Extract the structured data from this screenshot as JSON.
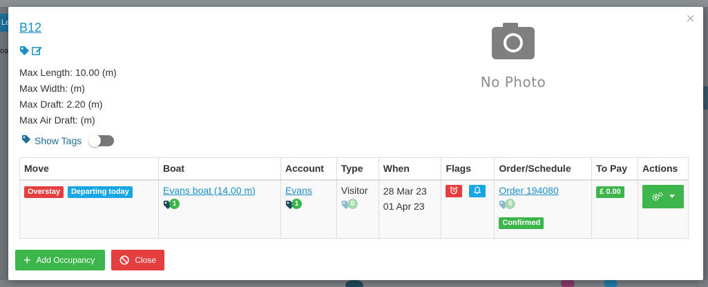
{
  "background": {
    "left_button_text": "Le",
    "left_side_text": "oa"
  },
  "modal": {
    "close_symbol": "×",
    "berth_name": "B12",
    "icons": [
      "tag-icon",
      "edit-icon"
    ],
    "specs": [
      "Max Length: 10.00 (m)",
      "Max Width: (m)",
      "Max Draft: 2.20 (m)",
      "Max Air Draft: (m)"
    ],
    "photo": {
      "icon": "camera-icon",
      "label": "No Photo"
    },
    "show_tags": {
      "label": "Show Tags",
      "enabled": false
    },
    "table": {
      "headers": [
        "Move",
        "Boat",
        "Account",
        "Type",
        "When",
        "Flags",
        "Order/Schedule",
        "To Pay",
        "Actions"
      ],
      "rows": [
        {
          "move_badges": [
            "Overstay",
            "Departing today"
          ],
          "boat": {
            "label": "Evans boat (14.00 m)",
            "tag_count": "1"
          },
          "account": {
            "label": "Evans",
            "tag_count": "1"
          },
          "type": {
            "label": "Visitor",
            "tag_count": "0"
          },
          "when": {
            "from": "28 Mar 23",
            "to": "01 Apr 23"
          },
          "flags": [
            "alarm-clock-icon",
            "bell-icon"
          ],
          "order": {
            "label": "Order 194080",
            "tag_count": "0",
            "status": "Confirmed"
          },
          "to_pay": "£ 0.00",
          "actions": {
            "icon": "gears-icon",
            "caret": "caret-down-icon"
          }
        }
      ]
    },
    "footer": {
      "add_label": "Add Occupancy",
      "close_label": "Close"
    }
  },
  "colors": {
    "link": "#1a8fc9",
    "green": "#3cb54a",
    "red": "#e53e3e",
    "blue": "#18a7e6"
  }
}
